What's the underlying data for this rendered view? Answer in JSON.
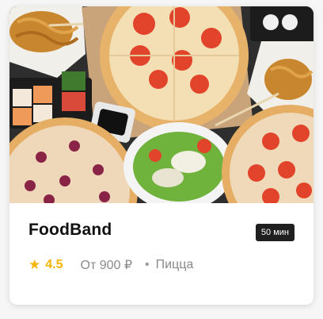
{
  "restaurant": {
    "name": "FoodBand",
    "delivery_time": "50 мин",
    "rating": "4.5",
    "price": "От 900 ₽",
    "separator": "•",
    "category": "Пицца"
  },
  "icons": {
    "rating": "star-icon"
  },
  "colors": {
    "rating": "#f5b400",
    "badge_bg": "#1f1f1f",
    "title": "#111111",
    "meta": "#8a8a8a"
  }
}
